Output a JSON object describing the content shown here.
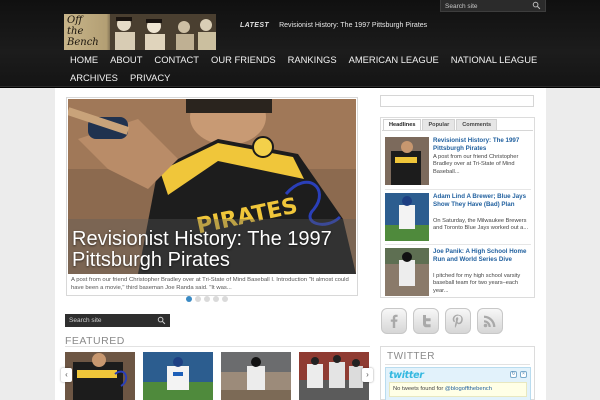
{
  "header": {
    "logo_text": "Off\nthe\nBench",
    "search_placeholder": "Search site",
    "latest_label": "LATEST",
    "latest_headline": "Revisionist History: The 1997 Pittsburgh Pirates"
  },
  "nav": {
    "items": [
      "HOME",
      "ABOUT",
      "CONTACT",
      "OUR FRIENDS",
      "RANKINGS",
      "AMERICAN LEAGUE",
      "NATIONAL LEAGUE",
      "ARCHIVES",
      "PRIVACY"
    ]
  },
  "slider": {
    "title": "Revisionist History: The 1997 Pittsburgh Pirates",
    "excerpt": "A post from our friend Christopher Bradley over at Tri-State of Mind Baseball I. Introduction \"It almost could have been a movie,\" third baseman Joe Randa said. \"It was...",
    "dots": 5,
    "active_dot": 0
  },
  "mid_search": {
    "placeholder": "Search site"
  },
  "featured": {
    "label": "FEATURED",
    "prev": "‹",
    "next": "›"
  },
  "sidebar": {
    "tabs": [
      "Headlines",
      "Popular",
      "Comments"
    ],
    "active_tab": 0,
    "stories": [
      {
        "title": "Revisionist History: The 1997 Pittsburgh Pirates",
        "excerpt": "A post from our friend Christopher Bradley over at Tri-State of Mind Baseball..."
      },
      {
        "title": "Adam Lind A Brewer; Blue Jays Show They Have (Bad) Plan",
        "excerpt": "On Saturday, the Milwaukee Brewers and Toronto Blue Jays worked out a..."
      },
      {
        "title": "Joe Panik: A High School Home Run and World Series Dive",
        "excerpt": "I pitched for my high school varsity baseball team for two years–each year..."
      }
    ]
  },
  "social": {
    "icons": [
      "facebook-icon",
      "twitter-icon",
      "pinterest-icon",
      "rss-icon"
    ]
  },
  "twitter": {
    "heading": "TWITTER",
    "logo": "twitter",
    "empty_prefix": "No tweets found for ",
    "handle": "@blogoffthebench"
  },
  "colors": {
    "accent_blue": "#1f5f9e",
    "header_bg": "#151515",
    "active_dot": "#3a8ac4"
  }
}
